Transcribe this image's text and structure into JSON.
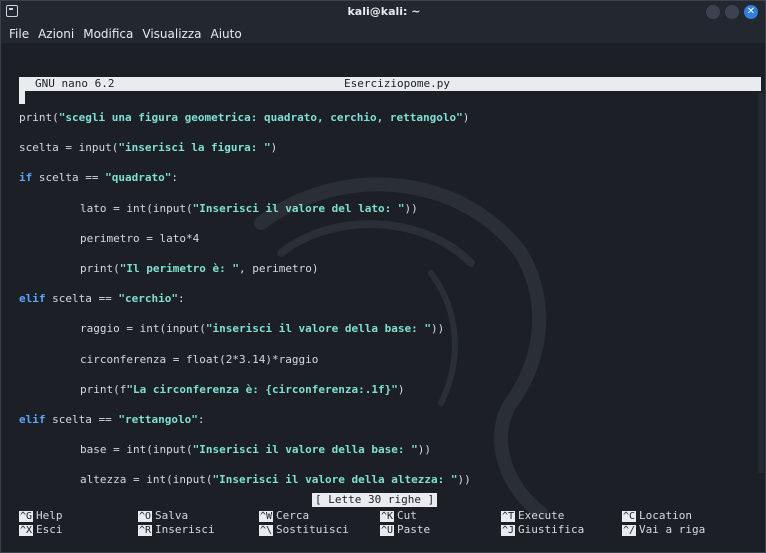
{
  "window": {
    "title": "kali@kali: ~",
    "close_glyph": "✕"
  },
  "menu": [
    "File",
    "Azioni",
    "Modifica",
    "Visualizza",
    "Aiuto"
  ],
  "nano": {
    "version": "GNU nano 6.2",
    "filename": "Eserciziopome.py"
  },
  "code": {
    "l1": [
      "print(",
      "\"scegli una figura geometrica: quadrato, cerchio, rettangolo\"",
      ")"
    ],
    "l2": [
      "scelta = input(",
      "\"inserisci la figura: \"",
      ")"
    ],
    "l3": [
      "if",
      " scelta == ",
      "\"quadrato\"",
      ":"
    ],
    "l4": [
      "lato = int(input(",
      "\"Inserisci il valore del lato: \"",
      "))"
    ],
    "l5": [
      "perimetro = lato*4"
    ],
    "l6": [
      "print(",
      "\"Il perimetro è: \"",
      ", perimetro)"
    ],
    "l7": [
      "elif",
      " scelta == ",
      "\"cerchio\"",
      ":"
    ],
    "l8": [
      "raggio = int(input(",
      "\"inserisci il valore della base: \"",
      "))"
    ],
    "l9": [
      "circonferenza = float(2*3.14)*raggio"
    ],
    "l10": [
      "print(f",
      "\"La circonferenza è: {circonferenza:.1f}\"",
      ")"
    ],
    "l11": [
      "elif",
      " scelta == ",
      "\"rettangolo\"",
      ":"
    ],
    "l12": [
      "base = int(input(",
      "\"Inserisci il valore della base: \"",
      "))"
    ],
    "l13": [
      "altezza = int(input(",
      "\"Inserisci il valore della altezza: \"",
      "))"
    ]
  },
  "status": "[ Lette 30 righe ]",
  "shortcuts": [
    {
      "key": "^G",
      "label": "Help"
    },
    {
      "key": "^X",
      "label": "Esci"
    },
    {
      "key": "^O",
      "label": "Salva"
    },
    {
      "key": "^R",
      "label": "Inserisci"
    },
    {
      "key": "^W",
      "label": "Cerca"
    },
    {
      "key": "^\\",
      "label": "Sostituisci"
    },
    {
      "key": "^K",
      "label": "Cut"
    },
    {
      "key": "^U",
      "label": "Paste"
    },
    {
      "key": "^T",
      "label": "Execute"
    },
    {
      "key": "^J",
      "label": "Giustifica"
    },
    {
      "key": "^C",
      "label": "Location"
    },
    {
      "key": "^/",
      "label": "Vai a riga"
    }
  ]
}
